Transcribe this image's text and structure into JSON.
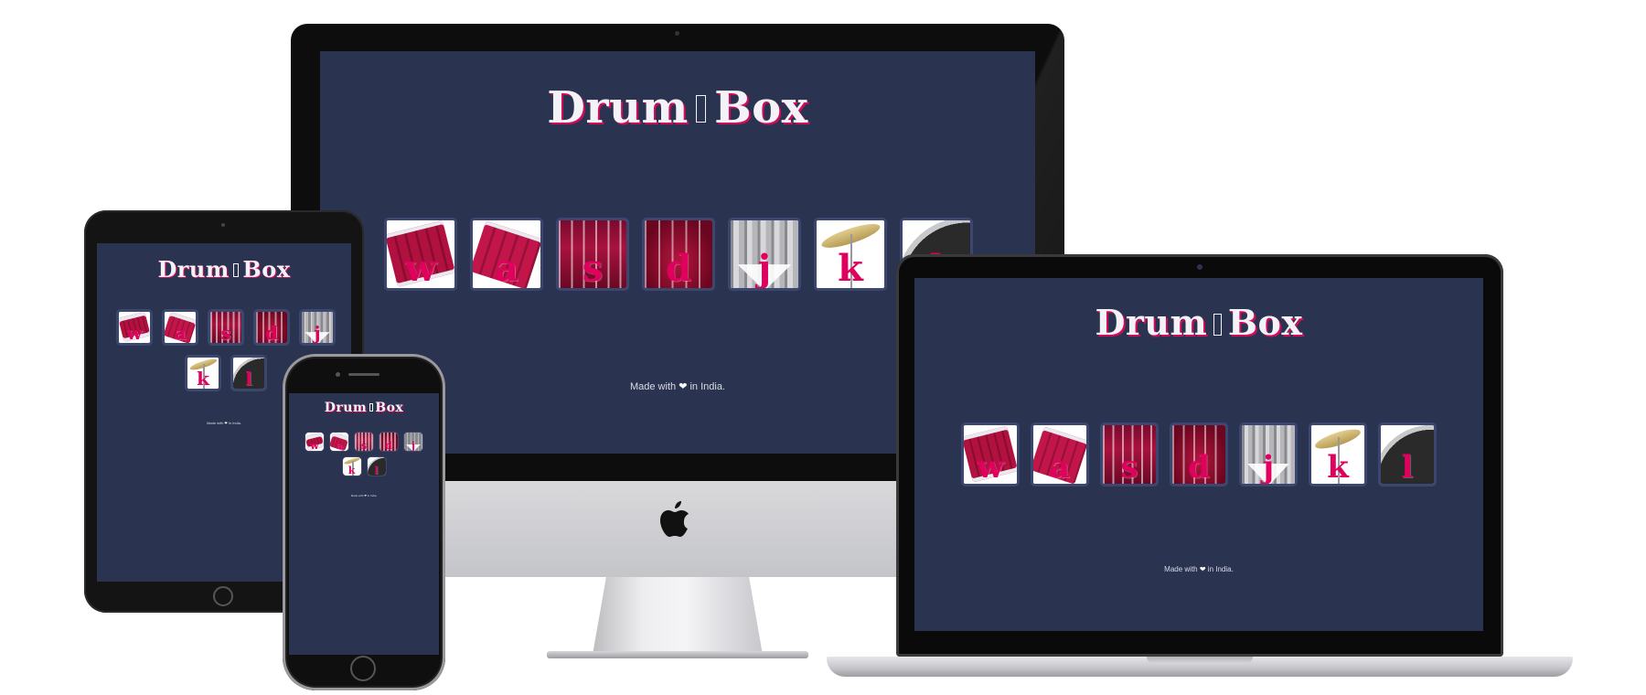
{
  "app": {
    "title_before": "Drum",
    "title_glyph": "",
    "title_after": "Box",
    "footer_before": "Made with",
    "heart": "❤",
    "footer_after": "in India."
  },
  "pads": [
    {
      "key": "w",
      "art": "tilt"
    },
    {
      "key": "a",
      "art": "tilt2"
    },
    {
      "key": "s",
      "art": "snare"
    },
    {
      "key": "d",
      "art": "tom"
    },
    {
      "key": "j",
      "art": "chrome"
    },
    {
      "key": "k",
      "art": "cymbal"
    },
    {
      "key": "l",
      "art": "kick"
    }
  ],
  "devices": [
    "imac",
    "ipad",
    "iphone",
    "macbook"
  ],
  "brand_logo": "apple-logo-icon",
  "colors": {
    "screen_bg": "#2a3350",
    "accent": "#e0005d",
    "pad_border": "#3c4770",
    "title_text": "#f3f3f7"
  }
}
